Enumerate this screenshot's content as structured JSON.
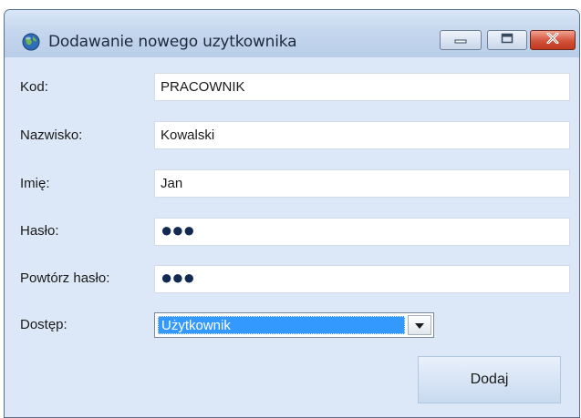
{
  "window": {
    "title": "Dodawanie nowego uzytkownika"
  },
  "form": {
    "kod": {
      "label": "Kod:",
      "value": "PRACOWNIK"
    },
    "nazwisko": {
      "label": "Nazwisko:",
      "value": "Kowalski"
    },
    "imie": {
      "label": "Imię:",
      "value": "Jan"
    },
    "haslo": {
      "label": "Hasło:",
      "value": "●●●"
    },
    "powtorz_haslo": {
      "label": "Powtórz hasło:",
      "value": "●●●"
    },
    "dostep": {
      "label": "Dostęp:",
      "value": "Użytkownik"
    }
  },
  "buttons": {
    "add": "Dodaj"
  },
  "colors": {
    "selection": "#3399ff",
    "close_button": "#c0391f",
    "client_background": "#dce8f7"
  },
  "icons": [
    "globe-icon",
    "minimize-icon",
    "maximize-icon",
    "close-icon",
    "dropdown-arrow-icon"
  ]
}
